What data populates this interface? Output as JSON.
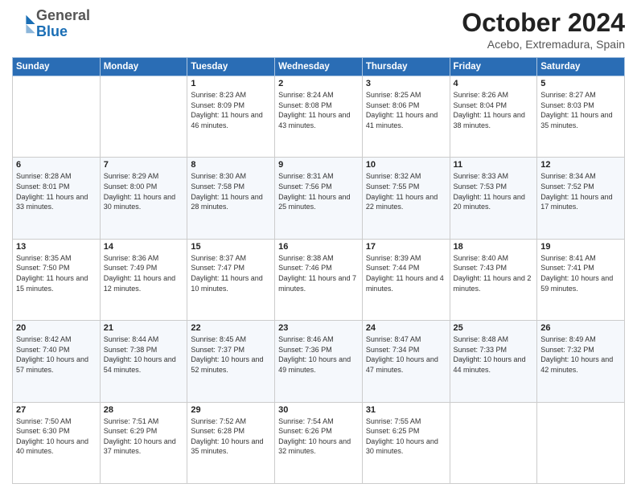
{
  "header": {
    "logo": {
      "general": "General",
      "blue": "Blue"
    },
    "title": "October 2024",
    "subtitle": "Acebo, Extremadura, Spain"
  },
  "calendar": {
    "days_of_week": [
      "Sunday",
      "Monday",
      "Tuesday",
      "Wednesday",
      "Thursday",
      "Friday",
      "Saturday"
    ],
    "weeks": [
      [
        {
          "day": "",
          "info": ""
        },
        {
          "day": "",
          "info": ""
        },
        {
          "day": "1",
          "info": "Sunrise: 8:23 AM\nSunset: 8:09 PM\nDaylight: 11 hours and 46 minutes."
        },
        {
          "day": "2",
          "info": "Sunrise: 8:24 AM\nSunset: 8:08 PM\nDaylight: 11 hours and 43 minutes."
        },
        {
          "day": "3",
          "info": "Sunrise: 8:25 AM\nSunset: 8:06 PM\nDaylight: 11 hours and 41 minutes."
        },
        {
          "day": "4",
          "info": "Sunrise: 8:26 AM\nSunset: 8:04 PM\nDaylight: 11 hours and 38 minutes."
        },
        {
          "day": "5",
          "info": "Sunrise: 8:27 AM\nSunset: 8:03 PM\nDaylight: 11 hours and 35 minutes."
        }
      ],
      [
        {
          "day": "6",
          "info": "Sunrise: 8:28 AM\nSunset: 8:01 PM\nDaylight: 11 hours and 33 minutes."
        },
        {
          "day": "7",
          "info": "Sunrise: 8:29 AM\nSunset: 8:00 PM\nDaylight: 11 hours and 30 minutes."
        },
        {
          "day": "8",
          "info": "Sunrise: 8:30 AM\nSunset: 7:58 PM\nDaylight: 11 hours and 28 minutes."
        },
        {
          "day": "9",
          "info": "Sunrise: 8:31 AM\nSunset: 7:56 PM\nDaylight: 11 hours and 25 minutes."
        },
        {
          "day": "10",
          "info": "Sunrise: 8:32 AM\nSunset: 7:55 PM\nDaylight: 11 hours and 22 minutes."
        },
        {
          "day": "11",
          "info": "Sunrise: 8:33 AM\nSunset: 7:53 PM\nDaylight: 11 hours and 20 minutes."
        },
        {
          "day": "12",
          "info": "Sunrise: 8:34 AM\nSunset: 7:52 PM\nDaylight: 11 hours and 17 minutes."
        }
      ],
      [
        {
          "day": "13",
          "info": "Sunrise: 8:35 AM\nSunset: 7:50 PM\nDaylight: 11 hours and 15 minutes."
        },
        {
          "day": "14",
          "info": "Sunrise: 8:36 AM\nSunset: 7:49 PM\nDaylight: 11 hours and 12 minutes."
        },
        {
          "day": "15",
          "info": "Sunrise: 8:37 AM\nSunset: 7:47 PM\nDaylight: 11 hours and 10 minutes."
        },
        {
          "day": "16",
          "info": "Sunrise: 8:38 AM\nSunset: 7:46 PM\nDaylight: 11 hours and 7 minutes."
        },
        {
          "day": "17",
          "info": "Sunrise: 8:39 AM\nSunset: 7:44 PM\nDaylight: 11 hours and 4 minutes."
        },
        {
          "day": "18",
          "info": "Sunrise: 8:40 AM\nSunset: 7:43 PM\nDaylight: 11 hours and 2 minutes."
        },
        {
          "day": "19",
          "info": "Sunrise: 8:41 AM\nSunset: 7:41 PM\nDaylight: 10 hours and 59 minutes."
        }
      ],
      [
        {
          "day": "20",
          "info": "Sunrise: 8:42 AM\nSunset: 7:40 PM\nDaylight: 10 hours and 57 minutes."
        },
        {
          "day": "21",
          "info": "Sunrise: 8:44 AM\nSunset: 7:38 PM\nDaylight: 10 hours and 54 minutes."
        },
        {
          "day": "22",
          "info": "Sunrise: 8:45 AM\nSunset: 7:37 PM\nDaylight: 10 hours and 52 minutes."
        },
        {
          "day": "23",
          "info": "Sunrise: 8:46 AM\nSunset: 7:36 PM\nDaylight: 10 hours and 49 minutes."
        },
        {
          "day": "24",
          "info": "Sunrise: 8:47 AM\nSunset: 7:34 PM\nDaylight: 10 hours and 47 minutes."
        },
        {
          "day": "25",
          "info": "Sunrise: 8:48 AM\nSunset: 7:33 PM\nDaylight: 10 hours and 44 minutes."
        },
        {
          "day": "26",
          "info": "Sunrise: 8:49 AM\nSunset: 7:32 PM\nDaylight: 10 hours and 42 minutes."
        }
      ],
      [
        {
          "day": "27",
          "info": "Sunrise: 7:50 AM\nSunset: 6:30 PM\nDaylight: 10 hours and 40 minutes."
        },
        {
          "day": "28",
          "info": "Sunrise: 7:51 AM\nSunset: 6:29 PM\nDaylight: 10 hours and 37 minutes."
        },
        {
          "day": "29",
          "info": "Sunrise: 7:52 AM\nSunset: 6:28 PM\nDaylight: 10 hours and 35 minutes."
        },
        {
          "day": "30",
          "info": "Sunrise: 7:54 AM\nSunset: 6:26 PM\nDaylight: 10 hours and 32 minutes."
        },
        {
          "day": "31",
          "info": "Sunrise: 7:55 AM\nSunset: 6:25 PM\nDaylight: 10 hours and 30 minutes."
        },
        {
          "day": "",
          "info": ""
        },
        {
          "day": "",
          "info": ""
        }
      ]
    ]
  }
}
